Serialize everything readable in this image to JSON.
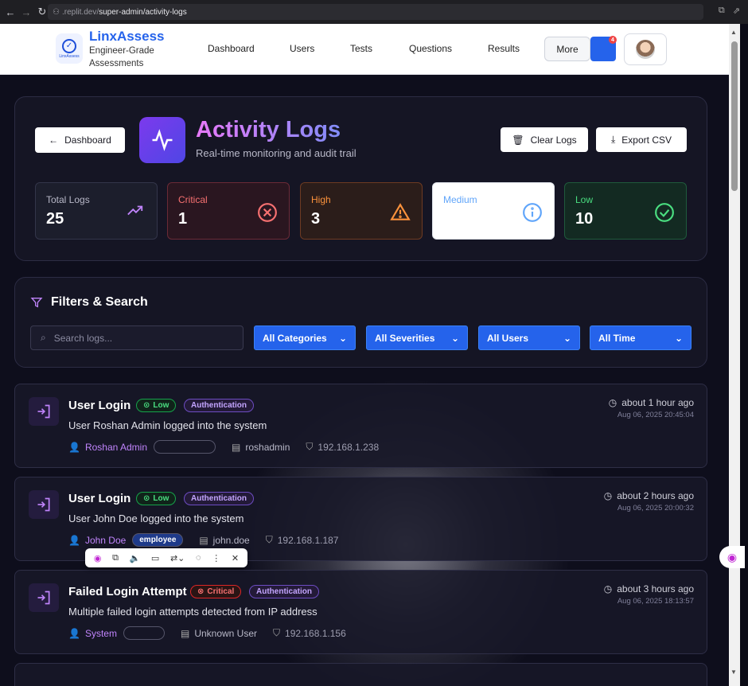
{
  "browser": {
    "url_prefix": ".replit.dev/",
    "url_path": "super-admin/activity-logs"
  },
  "header": {
    "logo_text": "LinxAssess",
    "brand": "LinxAssess",
    "tagline": "Engineer-Grade Assessments",
    "nav": [
      "Dashboard",
      "Users",
      "Tests",
      "Questions",
      "Results"
    ],
    "more_label": "More",
    "notification_count": "4"
  },
  "page": {
    "back_label": "Dashboard",
    "title": "Activity Logs",
    "subtitle": "Real-time monitoring and audit trail",
    "clear_label": "Clear Logs",
    "export_label": "Export CSV"
  },
  "stats": [
    {
      "label": "Total Logs",
      "value": "25"
    },
    {
      "label": "Critical",
      "value": "1"
    },
    {
      "label": "High",
      "value": "3"
    },
    {
      "label": "Medium",
      "value": ""
    },
    {
      "label": "Low",
      "value": "10"
    }
  ],
  "filters": {
    "heading": "Filters & Search",
    "search_placeholder": "Search logs...",
    "selects": [
      "All Categories",
      "All Severities",
      "All Users",
      "All Time"
    ]
  },
  "logs": [
    {
      "title": "User Login",
      "severity": "Low",
      "category": "Authentication",
      "description": "User Roshan Admin logged into the system",
      "user": "Roshan Admin",
      "role": "",
      "username": "roshadmin",
      "ip": "192.168.1.238",
      "relative": "about 1 hour ago",
      "timestamp": "Aug 06, 2025 20:45:04"
    },
    {
      "title": "User Login",
      "severity": "Low",
      "category": "Authentication",
      "description": "User John Doe logged into the system",
      "user": "John Doe",
      "role": "employee",
      "username": "john.doe",
      "ip": "192.168.1.187",
      "relative": "about 2 hours ago",
      "timestamp": "Aug 06, 2025 20:00:32"
    },
    {
      "title": "Failed Login Attempt",
      "severity": "Critical",
      "category": "Authentication",
      "description": "Multiple failed login attempts detected from IP address",
      "user": "System",
      "role": "",
      "username": "Unknown User",
      "ip": "192.168.1.156",
      "relative": "about 3 hours ago",
      "timestamp": "Aug 06, 2025 18:13:57"
    }
  ],
  "colors": {
    "accent": "#2563eb",
    "critical": "#f87171",
    "high": "#fb923c",
    "medium": "#60a5fa",
    "low": "#4ade80"
  }
}
